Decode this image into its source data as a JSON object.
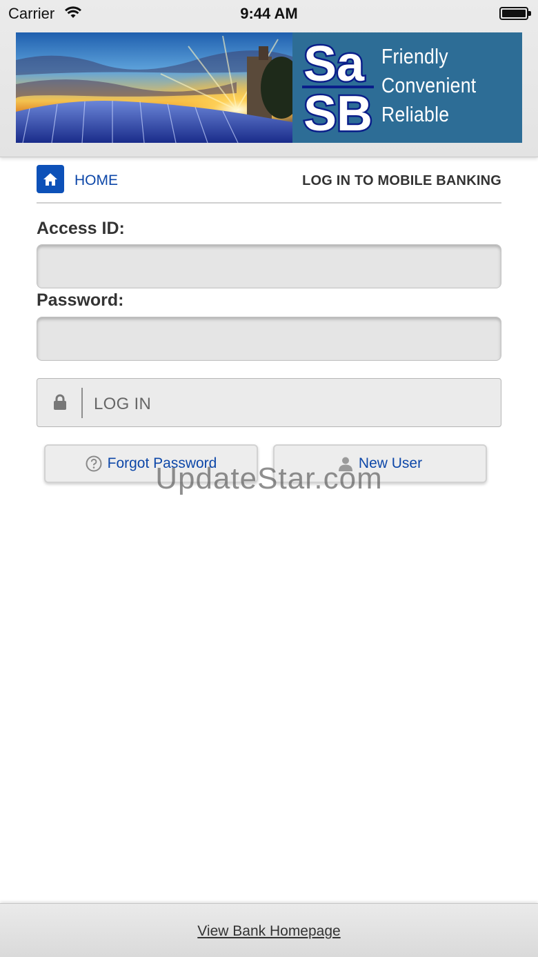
{
  "status_bar": {
    "carrier": "Carrier",
    "time": "9:44 AM"
  },
  "header": {
    "logo_text": "SASB",
    "tagline": [
      "Friendly",
      "Convenient",
      "Reliable"
    ],
    "logo_panel_color": "#2d6d96"
  },
  "nav": {
    "home_label": "HOME",
    "page_title": "LOG IN TO MOBILE BANKING",
    "accent_color": "#0d51b8"
  },
  "form": {
    "access_id_label": "Access ID:",
    "access_id_value": "",
    "password_label": "Password:",
    "password_value": "",
    "login_button": "LOG IN",
    "forgot_password": "Forgot Password",
    "new_user": "New User"
  },
  "icons": {
    "home": "home-icon",
    "lock": "lock-icon",
    "help": "question-circle-icon",
    "user": "user-icon"
  },
  "watermark": "UpdateStar.com",
  "footer": {
    "link": "View Bank Homepage"
  }
}
